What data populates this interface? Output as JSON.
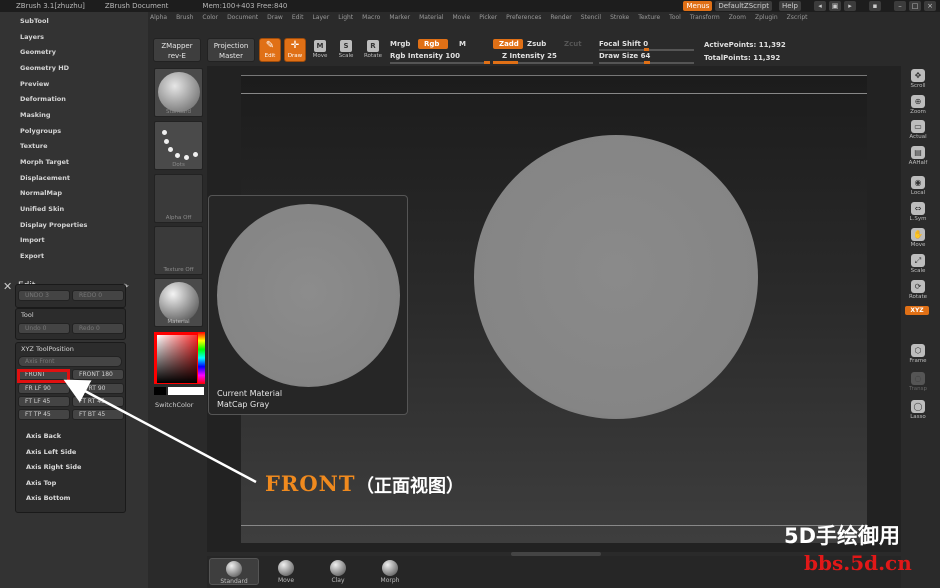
{
  "titlebar": {
    "app": "ZBrush 3.1[zhuzhu]",
    "document": "ZBrush Document",
    "mem": "Mem:100+403 Free:840",
    "menus": "Menus",
    "script": "DefaultZScript",
    "help": "Help"
  },
  "menubar": [
    "Alpha",
    "Brush",
    "Color",
    "Document",
    "Draw",
    "Edit",
    "Layer",
    "Light",
    "Macro",
    "Marker",
    "Material",
    "Movie",
    "Picker",
    "Preferences",
    "Render",
    "Stencil",
    "Stroke",
    "Texture",
    "Tool",
    "Transform",
    "Zoom",
    "Zplugin",
    "Zscript"
  ],
  "leftpanel": {
    "items": [
      "SubTool",
      "Layers",
      "Geometry",
      "Geometry HD",
      "Preview",
      "Deformation",
      "Masking",
      "Polygroups",
      "Texture",
      "Morph Target",
      "Displacement",
      "NormalMap",
      "Unified Skin",
      "Display Properties",
      "Import",
      "Export"
    ],
    "edit_label": "Edit",
    "undo": "UNDO 3",
    "redo": "REDO 0",
    "tool_title": "Tool",
    "tool_undo": "Undo 0",
    "tool_redo": "Redo 0",
    "xyz_title": "XYZ ToolPosition",
    "axis_front": "Axis Front",
    "positions": [
      "FRONT",
      "FRONT 180",
      "FR LF 90",
      "FR RT 90",
      "FT LF 45",
      "FT RT 45",
      "FT TP 45",
      "FT BT 45"
    ],
    "axes": [
      "Axis Back",
      "Axis Left Side",
      "Axis Right Side",
      "Axis Top",
      "Axis Bottom"
    ]
  },
  "thumbs": {
    "brush": "Standard",
    "stroke": "Dots",
    "alpha": "Alpha Off",
    "texture": "Texture Off",
    "material": "Material",
    "switch": "SwitchColor"
  },
  "toolbar": {
    "zmapper": "ZMapper",
    "zmapper_sub": "rev-E",
    "projection": "Projection",
    "projection_sub": "Master",
    "edit": "Edit",
    "draw": "Draw",
    "move": "Move",
    "scale": "Scale",
    "rotate": "Rotate",
    "mrgb": "Mrgb",
    "rgb": "Rgb",
    "m": "M",
    "rgb_intensity": "Rgb Intensity 100",
    "zadd": "Zadd",
    "zsub": "Zsub",
    "zcut": "Zcut",
    "z_intensity": "Z Intensity 25",
    "focal_shift": "Focal Shift 0",
    "draw_size": "Draw Size 64",
    "active_points": "ActivePoints: 11,392",
    "total_points": "TotalPoints: 11,392"
  },
  "popup": {
    "line1": "Current Material",
    "line2": "MatCap Gray"
  },
  "rightshelf": {
    "items": [
      "Scroll",
      "Zoom",
      "Actual",
      "AAHalf",
      "Local",
      "L.Sym",
      "Move",
      "Scale",
      "Rotate",
      "Frame",
      "Transp",
      "Lasso"
    ],
    "xyz": "XYZ"
  },
  "bottomshelf": {
    "items": [
      "Standard",
      "Move",
      "Clay",
      "Morph"
    ]
  },
  "annotation": {
    "label": "FRONT",
    "chinese": "（正面视图）"
  },
  "watermark": {
    "cn": "5D手绘御用",
    "url": "bbs.5d.cn"
  },
  "colors": {
    "accent": "#e07016",
    "annotation_red": "#e01010",
    "annotation_orange": "#f08a1e"
  }
}
